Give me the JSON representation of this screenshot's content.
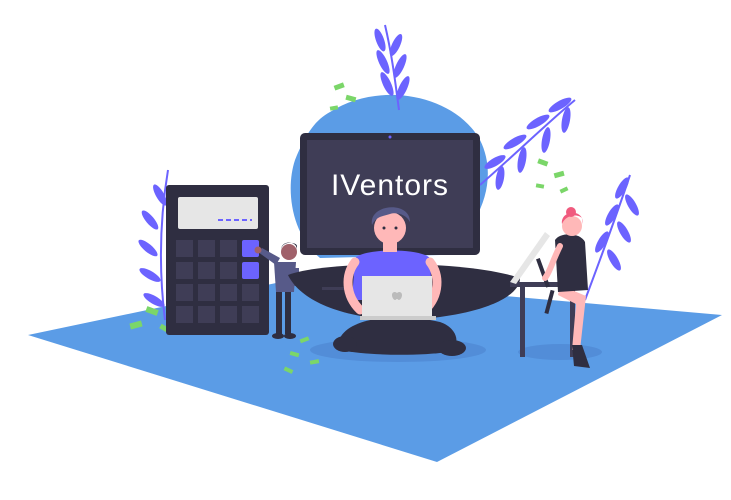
{
  "monitor": {
    "title": "IVentors"
  },
  "colors": {
    "floor": "#5B9CE6",
    "floor_dark": "#4C84CF",
    "blob": "#5B9CE6",
    "monitor_body": "#2F2E41",
    "monitor_screen": "#3F3D56",
    "accent": "#6C63FF",
    "leaf": "#6C63FF",
    "money": "#7BD669",
    "skin": "#FFB8B8",
    "hair_red": "#F05A7E"
  }
}
